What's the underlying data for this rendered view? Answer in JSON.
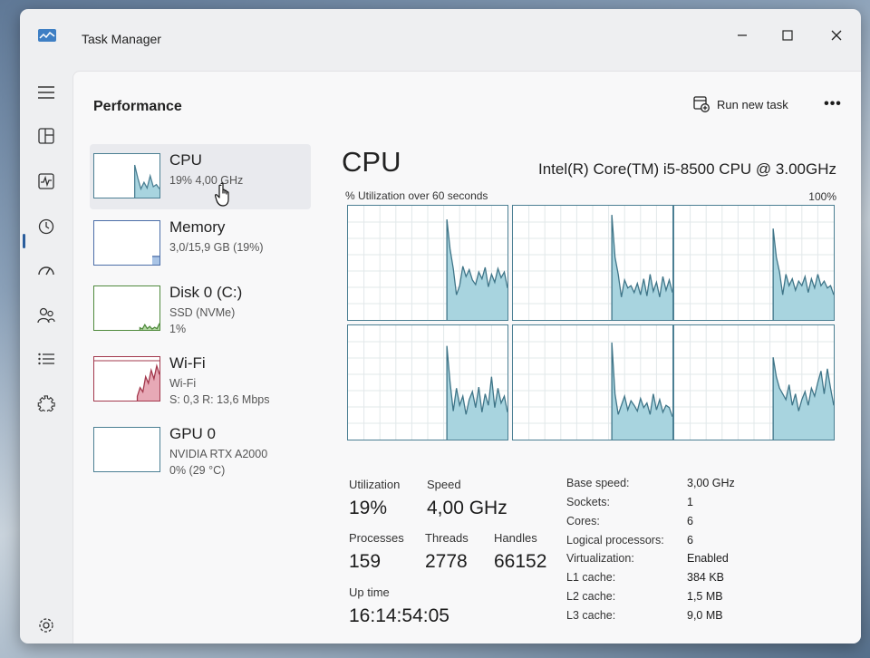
{
  "window": {
    "title": "Task Manager"
  },
  "header": {
    "title": "Performance",
    "run_new_task": "Run new task",
    "more": "•••"
  },
  "nav": {
    "items": [
      {
        "name": "hamburger-icon"
      },
      {
        "name": "processes-icon"
      },
      {
        "name": "performance-icon"
      },
      {
        "name": "app-history-icon"
      },
      {
        "name": "startup-apps-icon"
      },
      {
        "name": "users-icon"
      },
      {
        "name": "details-icon"
      },
      {
        "name": "services-icon"
      },
      {
        "name": "settings-icon"
      }
    ]
  },
  "devices": [
    {
      "name": "CPU",
      "line1": "19% 4,00 GHz",
      "line2": "",
      "graph_color": "#4b7f93",
      "fill": "#a8d4df"
    },
    {
      "name": "Memory",
      "line1": "3,0/15,9 GB (19%)",
      "line2": "",
      "graph_color": "#4b6ea8",
      "fill": "#a9c4e6",
      "level": 0.19
    },
    {
      "name": "Disk 0 (C:)",
      "line1": "SSD (NVMe)",
      "line2": "1%",
      "graph_color": "#4f8a3c",
      "fill": "#b5d8a5"
    },
    {
      "name": "Wi-Fi",
      "line1": "Wi-Fi",
      "line2": "S: 0,3  R: 13,6 Mbps",
      "graph_color": "#a3384d",
      "fill": "#e7a9b6"
    },
    {
      "name": "GPU 0",
      "line1": "NVIDIA RTX A2000",
      "line2": "0% (29 °C)",
      "graph_color": "#4b7f93",
      "fill": "#a8d4df"
    }
  ],
  "cpu": {
    "title": "CPU",
    "model": "Intel(R) Core(TM) i5-8500 CPU @ 3.00GHz",
    "util_label": "% Utilization over 60 seconds",
    "max_label": "100%",
    "line_color": "#3f7588",
    "fill_color": "#a8d4df",
    "cores": [
      [
        0,
        0,
        0,
        0,
        0,
        0,
        0,
        0,
        0,
        0,
        0,
        0,
        0,
        0,
        0,
        0,
        0,
        0,
        0,
        0,
        0,
        0,
        0,
        0,
        0,
        0,
        0,
        0,
        0,
        0,
        0,
        0,
        0,
        0,
        0,
        0,
        0,
        0,
        0,
        0,
        0,
        0,
        0,
        0,
        0,
        0,
        0,
        0,
        0,
        0,
        0,
        0,
        0,
        0,
        0,
        0,
        0,
        0,
        0,
        0,
        0,
        0,
        0,
        0,
        0,
        0,
        0,
        0,
        0,
        0,
        0,
        0,
        0,
        0,
        0,
        0,
        0,
        0,
        0,
        0
      ],
      [],
      [],
      [],
      [],
      []
    ],
    "core_series": [
      [
        0.88,
        0.62,
        0.45,
        0.22,
        0.3,
        0.47,
        0.38,
        0.44,
        0.35,
        0.31,
        0.42,
        0.36,
        0.46,
        0.29,
        0.4,
        0.33,
        0.45,
        0.37,
        0.42,
        0.28
      ],
      [
        0.92,
        0.55,
        0.4,
        0.2,
        0.35,
        0.28,
        0.3,
        0.24,
        0.32,
        0.22,
        0.36,
        0.21,
        0.4,
        0.25,
        0.33,
        0.2,
        0.38,
        0.26,
        0.35,
        0.24
      ],
      [
        0.8,
        0.55,
        0.42,
        0.22,
        0.4,
        0.3,
        0.36,
        0.26,
        0.34,
        0.3,
        0.38,
        0.24,
        0.36,
        0.28,
        0.4,
        0.3,
        0.34,
        0.28,
        0.3,
        0.22
      ],
      [
        0.82,
        0.5,
        0.25,
        0.45,
        0.3,
        0.38,
        0.22,
        0.35,
        0.42,
        0.28,
        0.46,
        0.24,
        0.4,
        0.3,
        0.55,
        0.28,
        0.45,
        0.32,
        0.38,
        0.24
      ],
      [
        0.85,
        0.4,
        0.22,
        0.3,
        0.38,
        0.26,
        0.34,
        0.3,
        0.25,
        0.36,
        0.28,
        0.32,
        0.22,
        0.4,
        0.26,
        0.35,
        0.24,
        0.3,
        0.28,
        0.2
      ],
      [
        0.72,
        0.55,
        0.45,
        0.4,
        0.35,
        0.48,
        0.3,
        0.4,
        0.25,
        0.35,
        0.42,
        0.3,
        0.45,
        0.38,
        0.5,
        0.6,
        0.4,
        0.62,
        0.45,
        0.3
      ]
    ]
  },
  "stats": {
    "utilization_label": "Utilization",
    "utilization": "19%",
    "speed_label": "Speed",
    "speed": "4,00 GHz",
    "processes_label": "Processes",
    "processes": "159",
    "threads_label": "Threads",
    "threads": "2778",
    "handles_label": "Handles",
    "handles": "66152",
    "uptime_label": "Up time",
    "uptime": "16:14:54:05"
  },
  "details": [
    {
      "label": "Base speed:",
      "value": "3,00 GHz"
    },
    {
      "label": "Sockets:",
      "value": "1"
    },
    {
      "label": "Cores:",
      "value": "6"
    },
    {
      "label": "Logical processors:",
      "value": "6"
    },
    {
      "label": "Virtualization:",
      "value": "Enabled"
    },
    {
      "label": "L1 cache:",
      "value": "384 KB"
    },
    {
      "label": "L2 cache:",
      "value": "1,5 MB"
    },
    {
      "label": "L3 cache:",
      "value": "9,0 MB"
    }
  ]
}
